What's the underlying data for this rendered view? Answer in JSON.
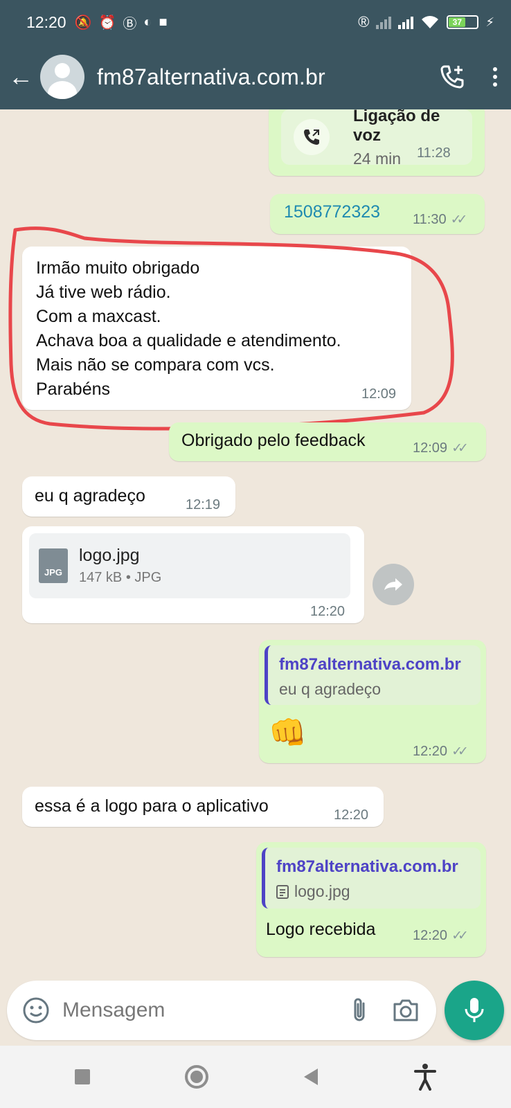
{
  "status_bar": {
    "time": "12:20",
    "battery": "37"
  },
  "header": {
    "contact_name": "fm87alternativa.com.br"
  },
  "messages": {
    "m1_call": {
      "title": "Ligação de voz",
      "duration": "24 min",
      "time": "11:28"
    },
    "m2": {
      "text": "1508772323",
      "time": "11:30"
    },
    "m3": {
      "lines": [
        "Irmão muito obrigado",
        "Já tive web rádio.",
        "Com a maxcast.",
        "Achava boa a qualidade e atendimento.",
        "Mais não se compara com vcs.",
        "Parabéns"
      ],
      "time": "12:09"
    },
    "m4": {
      "text": "Obrigado pelo feedback",
      "time": "12:09"
    },
    "m5": {
      "text": "eu q agradeço",
      "time": "12:19"
    },
    "m6_file": {
      "name": "logo.jpg",
      "meta": "147 kB • JPG",
      "icon_label": "JPG",
      "time": "12:20"
    },
    "m7": {
      "quote_name": "fm87alternativa.com.br",
      "quote_text": "eu q agradeço",
      "emoji": "👊",
      "time": "12:20"
    },
    "m8": {
      "text": "essa é a logo para o aplicativo",
      "time": "12:20"
    },
    "m9": {
      "quote_name": "fm87alternativa.com.br",
      "quote_text": "logo.jpg",
      "text": "Logo recebida",
      "time": "12:20"
    }
  },
  "composer": {
    "placeholder": "Mensagem"
  },
  "colors": {
    "header": "#3b5560",
    "outgoing_bubble": "#dcf8c6",
    "incoming_bubble": "#ffffff",
    "quote_accent": "#4e43c6",
    "mic_button": "#1aa589",
    "highlight_annotation": "#e8474b",
    "link_text": "#1f8ab0"
  }
}
